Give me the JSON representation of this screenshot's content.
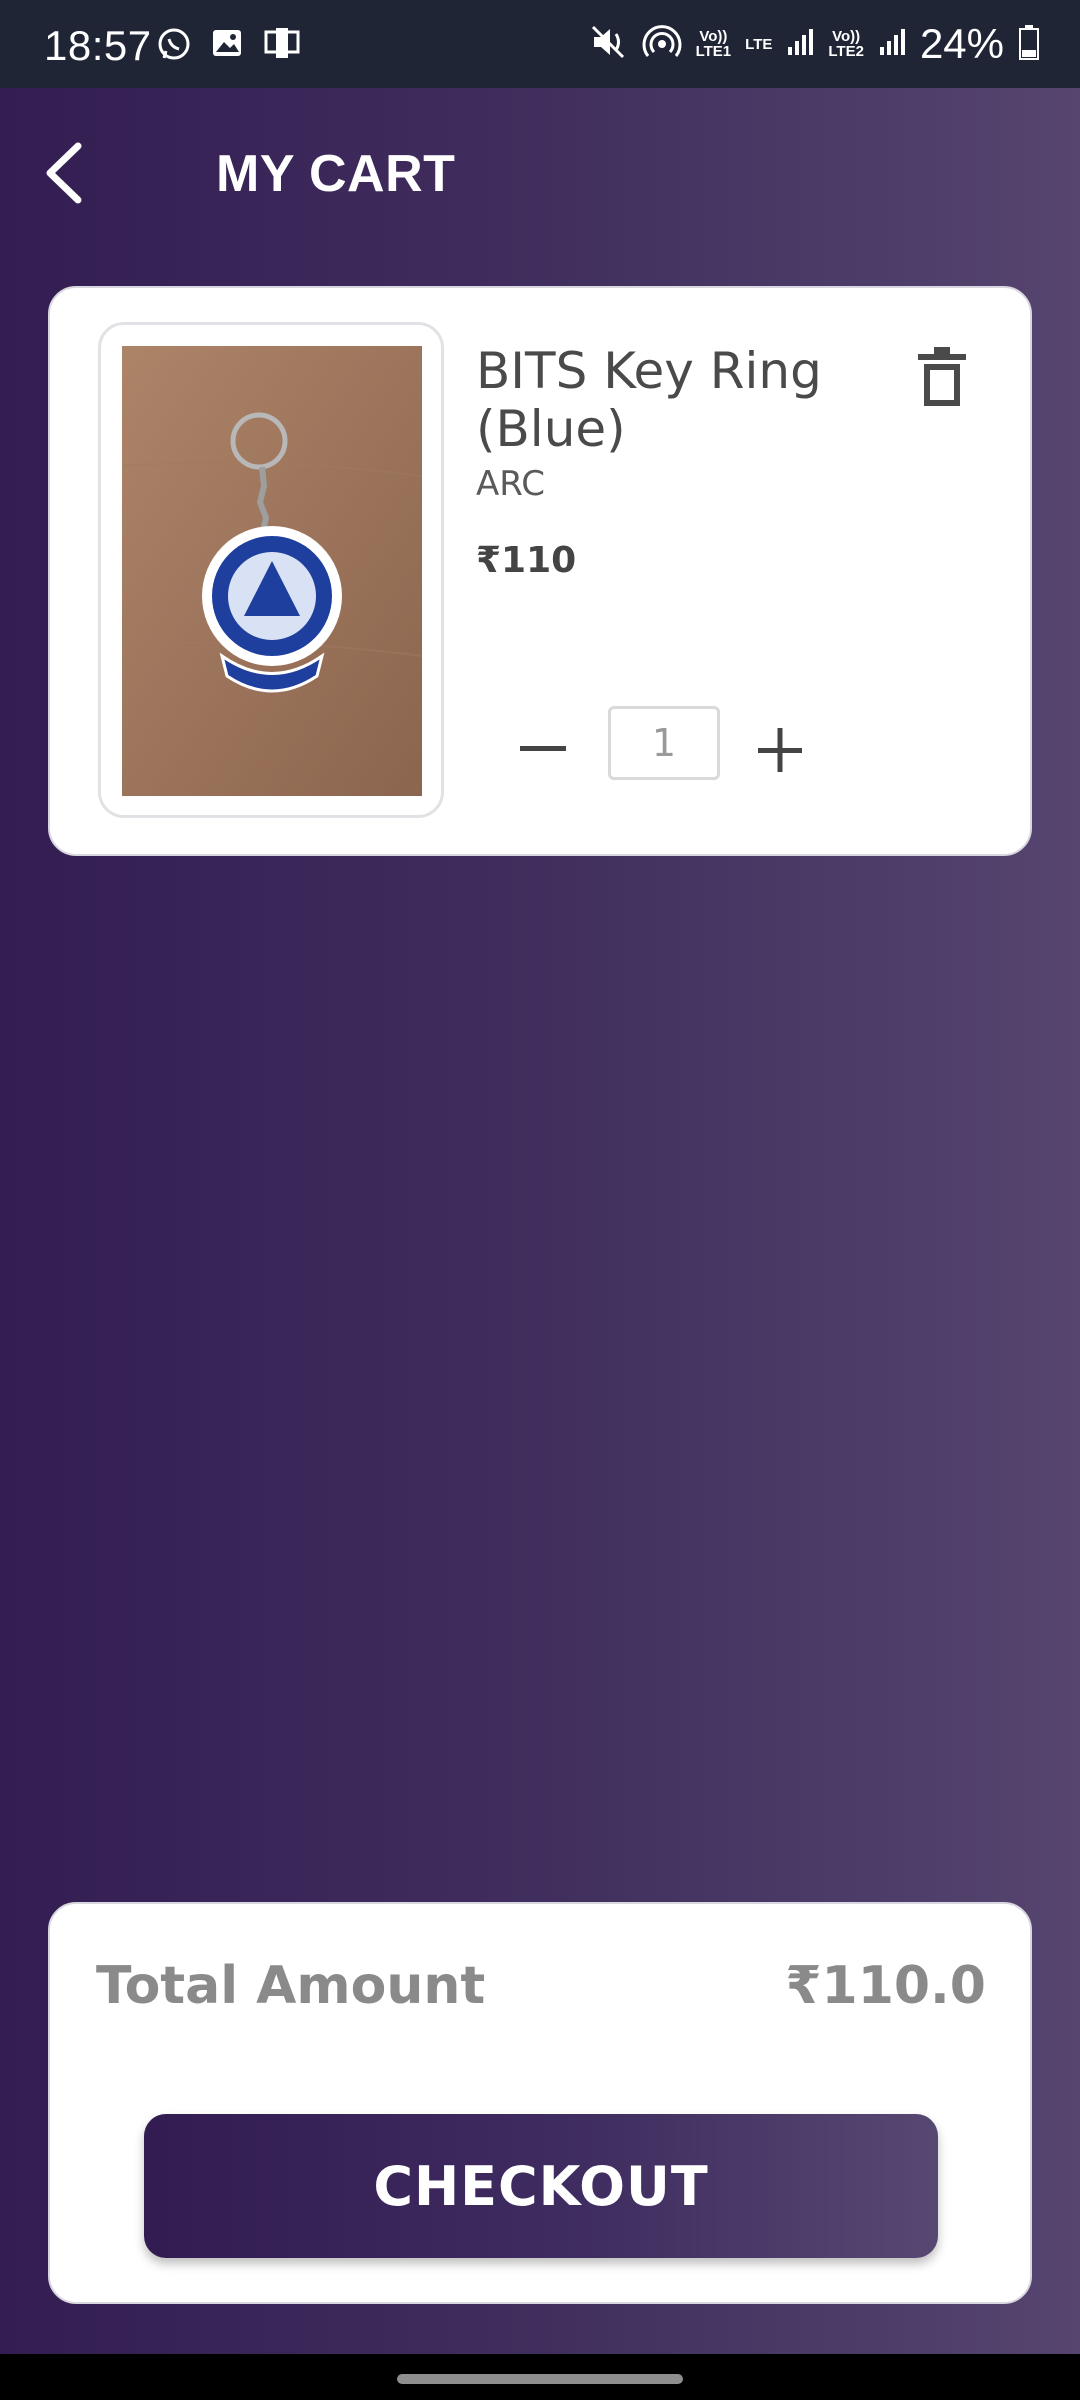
{
  "status_bar": {
    "time": "18:57",
    "battery": "24%",
    "sim1_label": "Vo))\nLTE1",
    "lte_label": "LTE",
    "sim2_label": "Vo))\nLTE2",
    "icons": [
      "whatsapp-icon",
      "gallery-icon",
      "screencast-icon",
      "mute-icon",
      "hotspot-icon",
      "signal-icon",
      "battery-icon"
    ]
  },
  "header": {
    "title": "MY CART",
    "back_icon": "chevron-left-icon"
  },
  "cart": {
    "items": [
      {
        "name": "BITS Key Ring (Blue)",
        "vendor": "ARC",
        "price": "₹110",
        "quantity": "1",
        "image": "blue-key-ring-photo"
      }
    ]
  },
  "summary": {
    "total_label": "Total Amount",
    "total_value": "₹110.0",
    "checkout_label": "CHECKOUT"
  },
  "colors": {
    "background_start": "#331d52",
    "background_end": "#56456f",
    "card": "#ffffff",
    "text_dark": "#4a4a4a",
    "text_muted": "#8a8a8a"
  }
}
